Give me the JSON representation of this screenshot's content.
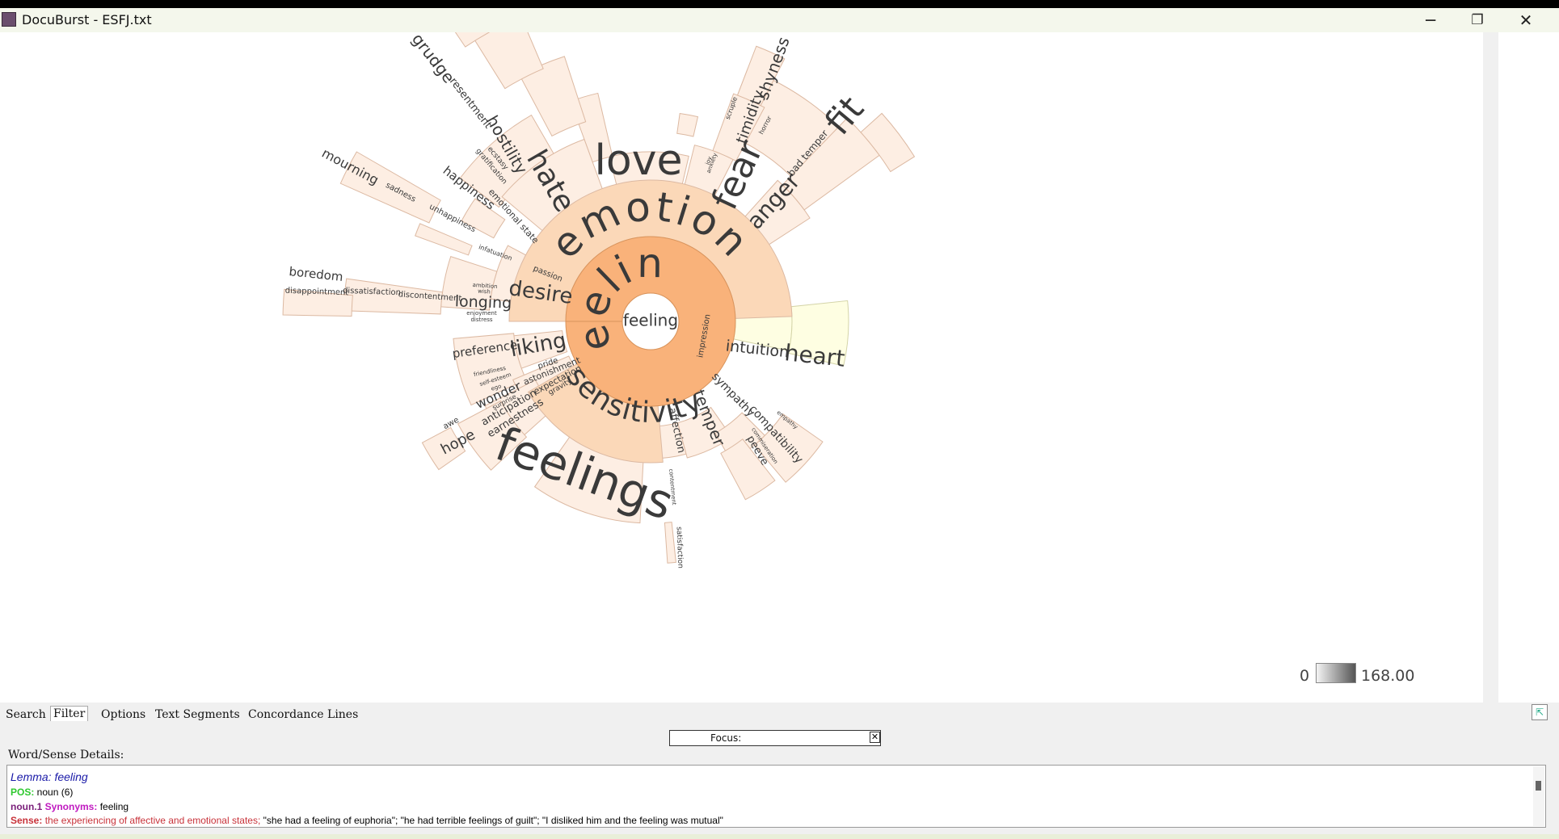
{
  "window": {
    "title": "DocuBurst - ESFJ.txt",
    "minimize_glyph": "─",
    "maximize_glyph": "❐",
    "close_glyph": "✕"
  },
  "colors": {
    "leaf_fill": "#fdeee3",
    "leaf_stroke": "#dcb9a2",
    "emotion_fill": "#fbd8b8",
    "core_fill": "#f9b27a",
    "yellow_fill": "#fefee2",
    "yellow_stroke": "#d4d4a8",
    "text_dark": "#3a3a3a"
  },
  "viz": {
    "center": "feeling",
    "feeling_ring": "feeling",
    "emotion_ring": "emotion",
    "sensitivity_ring": "sensitivity",
    "labels": {
      "love": "love",
      "hate": "hate",
      "fear": "fear",
      "anger": "anger",
      "grudge": "grudge",
      "resentment": "resentment",
      "hostility": "hostility",
      "timidity": "timidity",
      "shyness": "shyness",
      "scruple": "scruple",
      "horror": "horror",
      "fit": "fit",
      "bad_temper": "bad temper",
      "joy": "joy",
      "anxiety": "anxiety",
      "ecstasy": "ecstasy",
      "gratification": "gratification",
      "happiness": "happiness",
      "emotional_state": "emotional state",
      "mourning": "mourning",
      "sadness": "sadness",
      "unhappiness": "unhappiness",
      "infatuation": "infatuation",
      "passion": "passion",
      "boredom": "boredom",
      "disappointment": "disappointment",
      "dissatisfaction": "dissatisfaction",
      "discontentment": "discontentment",
      "longing": "longing",
      "ambition": "ambition",
      "wish": "wish",
      "desire": "desire",
      "enjoyment": "enjoyment",
      "distress": "distress",
      "preference": "preference",
      "liking": "liking",
      "friendliness": "friendliness",
      "pride": "pride",
      "self_esteem": "self-esteem",
      "ego": "ego",
      "astonishment": "astonishment",
      "expectation": "expectation",
      "gravity": "gravity",
      "wonder": "wonder",
      "surprise": "surprise",
      "anticipation": "anticipation",
      "earnestness": "earnestness",
      "awe": "awe",
      "hope": "hope",
      "feelings": "feelings",
      "affection": "affection",
      "temper": "temper",
      "sympathy": "sympathy",
      "compatibility": "compatibility",
      "peeve": "peeve",
      "commiseration": "commiseration",
      "empathy": "empathy",
      "contentment": "contentment",
      "satisfaction": "satisfaction",
      "impression": "impression",
      "intuition": "intuition",
      "heart": "heart"
    }
  },
  "legend": {
    "min": "0",
    "max": "168.00"
  },
  "tabs": [
    "Search",
    "Filter",
    "Options",
    "Text Segments",
    "Concordance Lines"
  ],
  "focus": {
    "label": "Focus:",
    "clear_glyph": "✕"
  },
  "details": {
    "label": "Word/Sense Details:",
    "lemma": "Lemma: feeling",
    "pos_key": "POS:",
    "pos_value": " noun (6)",
    "noun_key": "noun.1",
    "synonyms_key": "Synonyms:",
    "synonyms_value": " feeling",
    "sense_key": "Sense:",
    "sense_def": " the experiencing of affective and emotional states;",
    "sense_examples": " \"she had a feeling of euphoria\"; \"he had terrible feelings of guilt\"; \"I disliked him and the feeling was mutual\""
  }
}
